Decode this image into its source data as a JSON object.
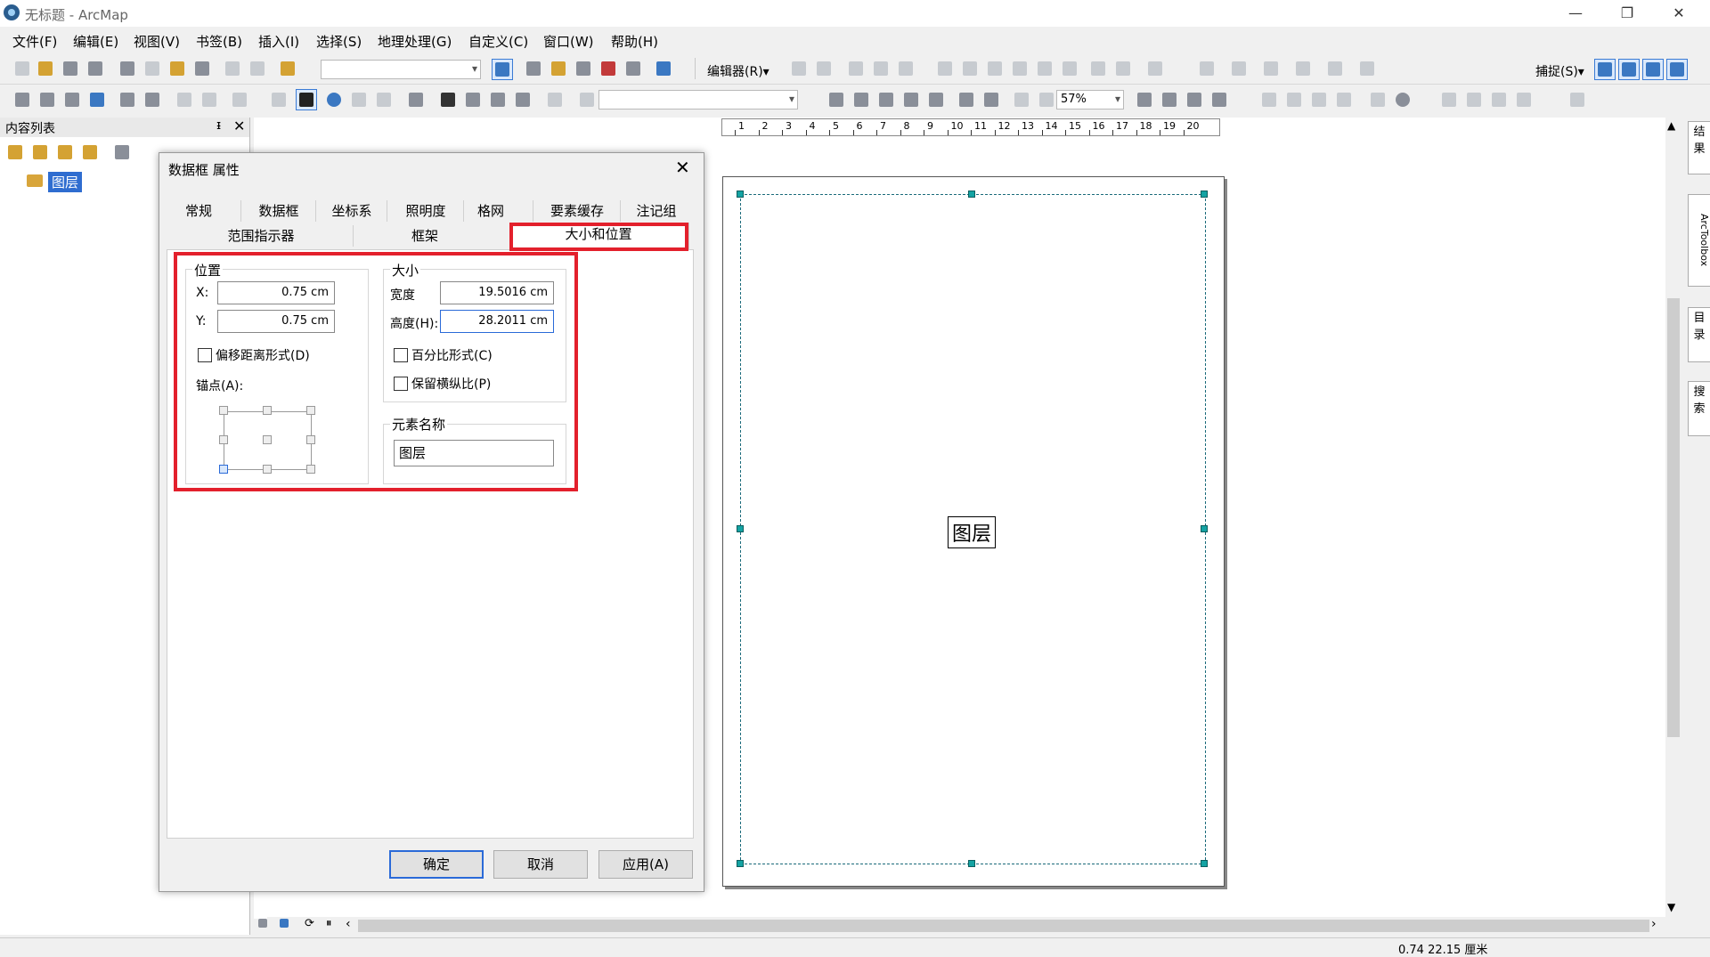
{
  "window": {
    "title": "无标题 - ArcMap",
    "minimize": "—",
    "restore": "❐",
    "close": "✕"
  },
  "menu": [
    "文件(F)",
    "编辑(E)",
    "视图(V)",
    "书签(B)",
    "插入(I)",
    "选择(S)",
    "地理处理(G)",
    "自定义(C)",
    "窗口(W)",
    "帮助(H)"
  ],
  "toolbar": {
    "editor_label": "编辑器(R)▾",
    "snap_label": "捕捉(S)▾",
    "zoom_value": "57%"
  },
  "toc": {
    "title": "内容列表",
    "pin": "ᵻ",
    "close": "✕",
    "layer": "图层"
  },
  "layout": {
    "ruler_labels": [
      "1",
      "2",
      "3",
      "4",
      "5",
      "6",
      "7",
      "8",
      "9",
      "10",
      "11",
      "12",
      "13",
      "14",
      "15",
      "16",
      "17",
      "18",
      "19",
      "20"
    ],
    "frame_label": "图层"
  },
  "right_tabs": [
    "结果",
    "ArcToolbox",
    "目录",
    "搜索"
  ],
  "status": {
    "coords": "0.74  22.15 厘米"
  },
  "dialog": {
    "title": "数据框 属性",
    "tabs_row1": [
      "常规",
      "数据框",
      "坐标系",
      "照明度",
      "格网",
      "要素缓存",
      "注记组"
    ],
    "tabs_row2": [
      "范围指示器",
      "框架",
      "大小和位置"
    ],
    "position": {
      "label": "位置",
      "x_label": "X:",
      "x_value": "0.75 cm",
      "y_label": "Y:",
      "y_value": "0.75 cm",
      "offset_label": "偏移距离形式(D)",
      "anchor_label": "锚点(A):"
    },
    "size": {
      "label": "大小",
      "width_label": "宽度",
      "width_value": "19.5016 cm",
      "height_label": "高度(H):",
      "height_value": "28.2011 cm",
      "percent_label": "百分比形式(C)",
      "keep_ratio_label": "保留横纵比(P)"
    },
    "element_name": {
      "label": "元素名称",
      "value": "图层"
    },
    "buttons": {
      "ok": "确定",
      "cancel": "取消",
      "apply": "应用(A)"
    }
  }
}
